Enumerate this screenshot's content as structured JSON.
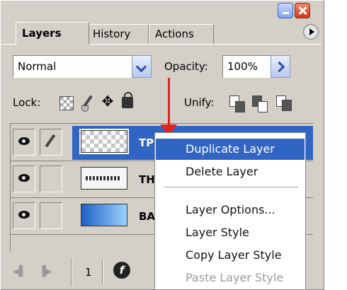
{
  "tabs": [
    {
      "label": "Layers",
      "active": true
    },
    {
      "label": "History",
      "active": false
    },
    {
      "label": "Actions",
      "active": false
    }
  ],
  "blend_mode": {
    "value": "Normal"
  },
  "opacity": {
    "label": "Opacity:",
    "value": "100%"
  },
  "lock": {
    "label": "Lock:"
  },
  "unify": {
    "label": "Unify:"
  },
  "layers": [
    {
      "name": "TP",
      "selected": true,
      "visible": true
    },
    {
      "name": "THAI",
      "selected": false,
      "visible": true
    },
    {
      "name": "BACK",
      "selected": false,
      "visible": true
    }
  ],
  "bottom_bar": {
    "count": "1",
    "fx_label": "f"
  },
  "context_menu": {
    "items": [
      {
        "label": "Duplicate Layer",
        "highlighted": true,
        "disabled": false
      },
      {
        "label": "Delete Layer",
        "highlighted": false,
        "disabled": false
      },
      {
        "label": "Layer Options...",
        "highlighted": false,
        "disabled": false
      },
      {
        "label": "Layer Style",
        "highlighted": false,
        "disabled": false
      },
      {
        "label": "Copy Layer Style",
        "highlighted": false,
        "disabled": false
      },
      {
        "label": "Paste Layer Style",
        "highlighted": false,
        "disabled": true
      }
    ]
  },
  "colors": {
    "selection": "#3165c3",
    "panel": "#d4d0c8",
    "annotation_arrow": "#e0241b"
  }
}
